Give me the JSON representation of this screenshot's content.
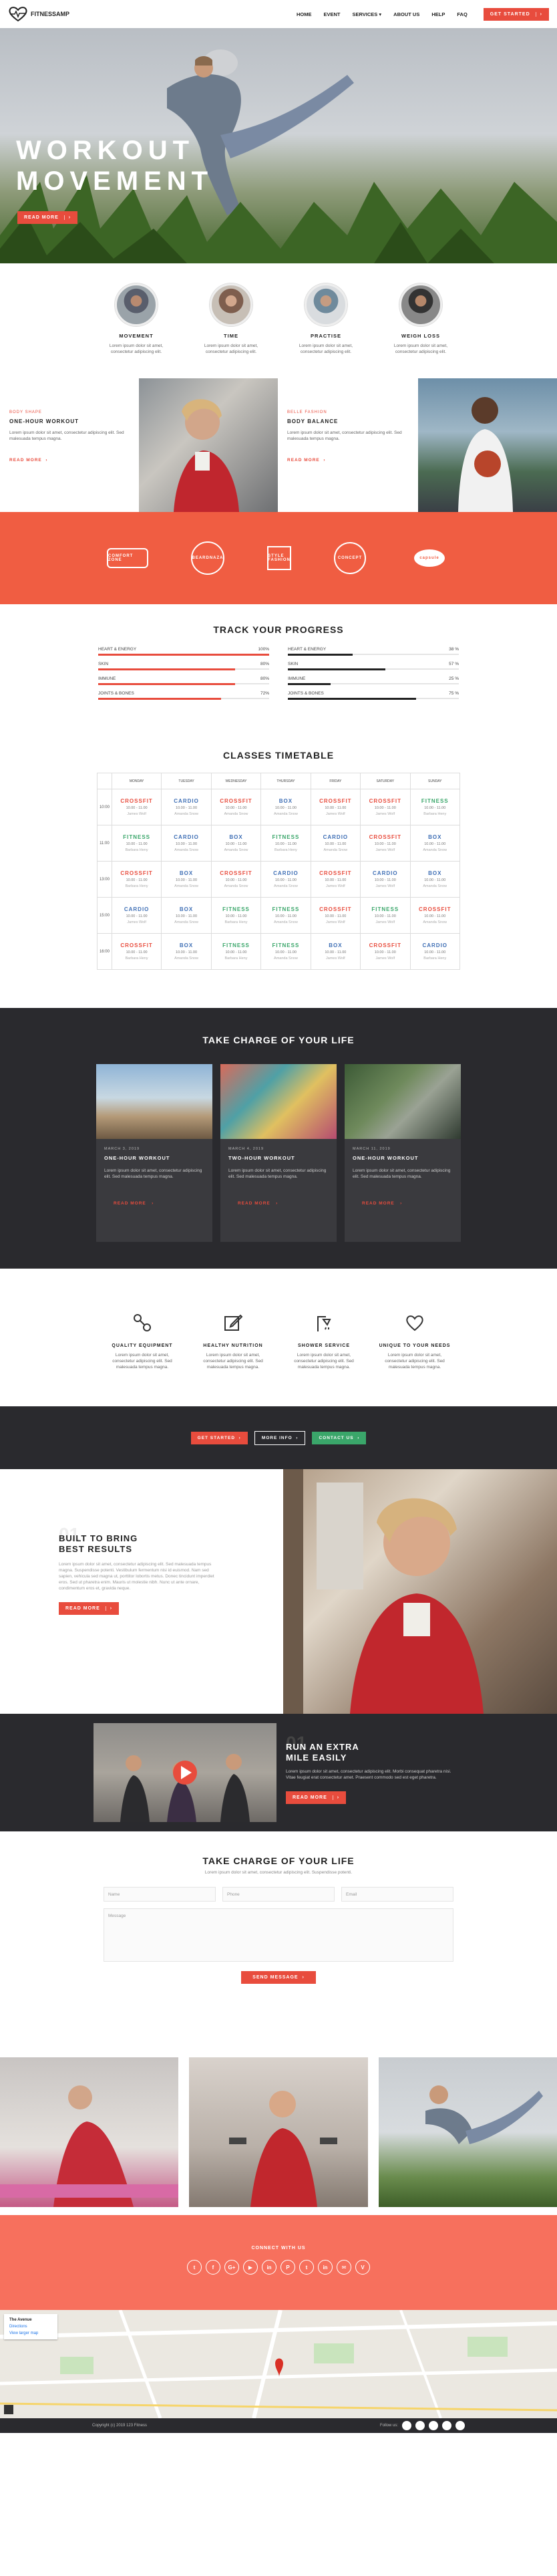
{
  "header": {
    "brand": "FITNESSAMP",
    "nav": [
      "HOME",
      "EVENT",
      "SERVICES ▾",
      "ABOUT US",
      "HELP",
      "FAQ"
    ],
    "cta": "GET STARTED"
  },
  "hero": {
    "title_line1": "WORKOUT",
    "title_line2": "MOVEMENT",
    "button": "READ MORE"
  },
  "features": [
    {
      "title": "MOVEMENT",
      "text": "Lorem ipsum dolor sit amet, consectetur adipiscing elit."
    },
    {
      "title": "TIME",
      "text": "Lorem ipsum dolor sit amet, consectetur adipiscing elit."
    },
    {
      "title": "PRACTISE",
      "text": "Lorem ipsum dolor sit amet, consectetur adipiscing elit."
    },
    {
      "title": "WEIGH LOSS",
      "text": "Lorem ipsum dolor sit amet, consectetur adipiscing elit."
    }
  ],
  "workouts": [
    {
      "category": "BODY SHAPE",
      "title": "ONE-HOUR WORKOUT",
      "text": "Lorem ipsum dolor sit amet, consectetur adipiscing elit. Sed malesuada tempus magna.",
      "more": "READ MORE"
    },
    {
      "category": "BELLE FASHION",
      "title": "BODY BALANCE",
      "text": "Lorem ipsum dolor sit amet, consectetur adipiscing elit. Sed malesuada tempus magna.",
      "more": "READ MORE"
    }
  ],
  "sponsors": [
    "COMFORT ZONE",
    "BEARDNAZA",
    "STYLE FASHION",
    "CONCEPT",
    "capsule"
  ],
  "progress": {
    "title": "TRACK YOUR PROGRESS",
    "left": [
      {
        "label": "HEART & ENERGY",
        "value": 100,
        "text": "100%"
      },
      {
        "label": "SKIN",
        "value": 80,
        "text": "80%"
      },
      {
        "label": "IMMUNE",
        "value": 80,
        "text": "80%"
      },
      {
        "label": "JOINTS & BONES",
        "value": 72,
        "text": "72%"
      }
    ],
    "right": [
      {
        "label": "HEART & ENERGY",
        "value": 38,
        "text": "38 %"
      },
      {
        "label": "SKIN",
        "value": 57,
        "text": "57 %"
      },
      {
        "label": "IMMUNE",
        "value": 25,
        "text": "25 %"
      },
      {
        "label": "JOINTS & BONES",
        "value": 75,
        "text": "75 %"
      }
    ],
    "left_color": "#e84c3d",
    "right_color": "#222222"
  },
  "timetable": {
    "title": "CLASSES TIMETABLE",
    "days": [
      "MONDAY",
      "TUESDAY",
      "WEDNESDAY",
      "THURSDAY",
      "FRIDAY",
      "SATURDAY",
      "SUNDAY"
    ],
    "rows": [
      {
        "time": "10:00",
        "cells": [
          [
            "CROSSFIT",
            "10.00 - 11.00",
            "James Wolf"
          ],
          [
            "CARDIO",
            "10.00 - 11.00",
            "Amanda Snow"
          ],
          [
            "CROSSFIT",
            "10.00 - 11.00",
            "Amanda Snow"
          ],
          [
            "BOX",
            "10.00 - 11.00",
            "Amanda Snow"
          ],
          [
            "CROSSFIT",
            "10.00 - 11.00",
            "James Wolf"
          ],
          [
            "CROSSFIT",
            "10.00 - 11.00",
            "James Wolf"
          ],
          [
            "FITNESS",
            "10.00 - 11.00",
            "Barbara Heny"
          ]
        ]
      },
      {
        "time": "11:00",
        "cells": [
          [
            "FITNESS",
            "10.00 - 11.00",
            "Barbara Heny"
          ],
          [
            "CARDIO",
            "10.00 - 11.00",
            "Amanda Snow"
          ],
          [
            "BOX",
            "10.00 - 11.00",
            "Amanda Snow"
          ],
          [
            "FITNESS",
            "10.00 - 11.00",
            "Barbara Heny"
          ],
          [
            "CARDIO",
            "10.00 - 11.00",
            "Amanda Snow"
          ],
          [
            "CROSSFIT",
            "10.00 - 11.00",
            "James Wolf"
          ],
          [
            "BOX",
            "10.00 - 11.00",
            "Amanda Snow"
          ]
        ]
      },
      {
        "time": "13:00",
        "cells": [
          [
            "CROSSFIT",
            "10.00 - 11.00",
            "Barbara Heny"
          ],
          [
            "BOX",
            "10.00 - 11.00",
            "Amanda Snow"
          ],
          [
            "CROSSFIT",
            "10.00 - 11.00",
            "Amanda Snow"
          ],
          [
            "CARDIO",
            "10.00 - 11.00",
            "Amanda Snow"
          ],
          [
            "CROSSFIT",
            "10.00 - 11.00",
            "James Wolf"
          ],
          [
            "CARDIO",
            "10.00 - 11.00",
            "James Wolf"
          ],
          [
            "BOX",
            "10.00 - 11.00",
            "Amanda Snow"
          ]
        ]
      },
      {
        "time": "15:00",
        "cells": [
          [
            "CARDIO",
            "10.00 - 11.00",
            "James Wolf"
          ],
          [
            "BOX",
            "10.00 - 11.00",
            "Amanda Snow"
          ],
          [
            "FITNESS",
            "10.00 - 11.00",
            "Barbara Heny"
          ],
          [
            "FITNESS",
            "10.00 - 11.00",
            "Amanda Snow"
          ],
          [
            "CROSSFIT",
            "10.00 - 11.00",
            "James Wolf"
          ],
          [
            "FITNESS",
            "10.00 - 11.00",
            "James Wolf"
          ],
          [
            "CROSSFIT",
            "10.00 - 11.00",
            "Amanda Snow"
          ]
        ]
      },
      {
        "time": "16:00",
        "cells": [
          [
            "CROSSFIT",
            "10.00 - 11.00",
            "Barbara Heny"
          ],
          [
            "BOX",
            "10.00 - 11.00",
            "Amanda Snow"
          ],
          [
            "FITNESS",
            "10.00 - 11.00",
            "Barbara Heny"
          ],
          [
            "FITNESS",
            "10.00 - 11.00",
            "Amanda Snow"
          ],
          [
            "BOX",
            "10.00 - 11.00",
            "James Wolf"
          ],
          [
            "CROSSFIT",
            "10.00 - 11.00",
            "James Wolf"
          ],
          [
            "CARDIO",
            "10.00 - 11.00",
            "Barbara Heny"
          ]
        ]
      }
    ],
    "colors": {
      "CROSSFIT": "#e84c3d",
      "CARDIO": "#3f6fb5",
      "BOX": "#3f6fb5",
      "FITNESS": "#3aa66a"
    }
  },
  "blog": {
    "title": "TAKE CHARGE OF YOUR LIFE",
    "posts": [
      {
        "date": "MARCH 3, 2019",
        "title": "ONE-HOUR WORKOUT",
        "text": "Lorem ipsum dolor sit amet, consectetur adipiscing elit. Sed malesuada tempus magna.",
        "more": "READ MORE"
      },
      {
        "date": "MARCH 4, 2019",
        "title": "TWO-HOUR WORKOUT",
        "text": "Lorem ipsum dolor sit amet, consectetur adipiscing elit. Sed malesuada tempus magna.",
        "more": "READ MORE"
      },
      {
        "date": "MARCH 11, 2019",
        "title": "ONE-HOUR WORKOUT",
        "text": "Lorem ipsum dolor sit amet, consectetur adipiscing elit. Sed malesuada tempus magna.",
        "more": "READ MORE"
      }
    ]
  },
  "services": [
    {
      "icon": "dumbbell-icon",
      "title": "QUALITY EQUIPMENT",
      "text": "Lorem ipsum dolor sit amet, consectetur adipiscing elit. Sed malesuada tempus magna."
    },
    {
      "icon": "edit-icon",
      "title": "HEALTHY NUTRITION",
      "text": "Lorem ipsum dolor sit amet, consectetur adipiscing elit. Sed malesuada tempus magna."
    },
    {
      "icon": "shower-icon",
      "title": "SHOWER SERVICE",
      "text": "Lorem ipsum dolor sit amet, consectetur adipiscing elit. Sed malesuada tempus magna."
    },
    {
      "icon": "heart-icon",
      "title": "UNIQUE TO YOUR NEEDS",
      "text": "Lorem ipsum dolor sit amet, consectetur adipiscing elit. Sed malesuada tempus magna."
    }
  ],
  "cta_band": [
    {
      "label": "GET STARTED",
      "color": "#e84c3d"
    },
    {
      "label": "MORE INFO",
      "color": "#2a2a2e"
    },
    {
      "label": "CONTACT US",
      "color": "#3aa66a"
    }
  ],
  "built": {
    "num": "01",
    "title_line1": "BUILT TO BRING",
    "title_line2": "BEST RESULTS",
    "text": "Lorem ipsum dolor sit amet, consectetur adipiscing elit. Sed malesuada tempus magna. Suspendisse potenti. Vestibulum fermentum nisi id euismod. Nam sed sapien, vehicula sed magna ut, porttitor lobortis metus. Donec tincidunt imperdiet eros. Sed ut pharetra enim. Mauris ut molestie nibh. Nunc ut ante ornare, condimentum eros et, gravida neque.",
    "button": "READ MORE"
  },
  "run": {
    "num": "01",
    "title_line1": "RUN AN EXTRA",
    "title_line2": "MILE EASILY",
    "text": "Lorem ipsum dolor sit amet, consectetur adipiscing elit. Morbi consequat pharetra nisi. Vitae feugiat erat consectetur amet. Praesent commodo sed est eget pharetra.",
    "button": "READ MORE"
  },
  "contact": {
    "title": "TAKE CHARGE OF YOUR LIFE",
    "subtitle": "Lorem ipsum dolor sit amet, consectetur adipiscing elit. Suspendisse potenti.",
    "name": "Name",
    "phone": "Phone",
    "email": "Email",
    "message": "Message",
    "button": "SEND MESSAGE"
  },
  "connect": {
    "title": "CONNECT WITH US",
    "icons": [
      "t",
      "f",
      "G+",
      "▶",
      "in",
      "P",
      "t",
      "in",
      "✉",
      "V"
    ]
  },
  "map": {
    "place": "The Avenue",
    "directions": "Directions",
    "larger": "View larger map"
  },
  "footer": {
    "copyright": "Copyright (c) 2019 123 Fitness",
    "follow": "Follow us:"
  }
}
